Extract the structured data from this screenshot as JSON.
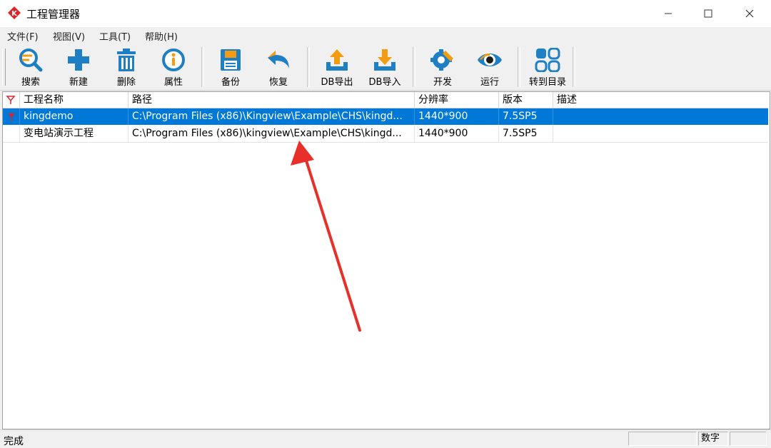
{
  "window": {
    "title": "工程管理器"
  },
  "menu": [
    "文件(F)",
    "视图(V)",
    "工具(T)",
    "帮助(H)"
  ],
  "toolbar": {
    "search": "搜索",
    "new": "新建",
    "delete": "删除",
    "properties": "属性",
    "backup": "备份",
    "restore": "恢复",
    "db_export": "DB导出",
    "db_import": "DB导入",
    "develop": "开发",
    "run": "运行",
    "goto_dir": "转到目录"
  },
  "table": {
    "columns": [
      "工程名称",
      "路径",
      "分辨率",
      "版本",
      "描述"
    ],
    "rows": [
      {
        "name": "kingdemo",
        "path": "C:\\Program Files (x86)\\Kingview\\Example\\CHS\\kingd...",
        "resolution": "1440*900",
        "version": "7.5SP5",
        "desc": "",
        "selected": true
      },
      {
        "name": "变电站演示工程",
        "path": "C:\\Program Files (x86)\\kingview\\Example\\CHS\\kingd...",
        "resolution": "1440*900",
        "version": "7.5SP5",
        "desc": "",
        "selected": false
      }
    ]
  },
  "status": {
    "text": "完成",
    "numlock": "数字"
  },
  "colors": {
    "selection": "#0078d7",
    "accent_orange": "#f39c12",
    "icon_blue": "#1e7fc4",
    "arrow": "#e8302a"
  }
}
